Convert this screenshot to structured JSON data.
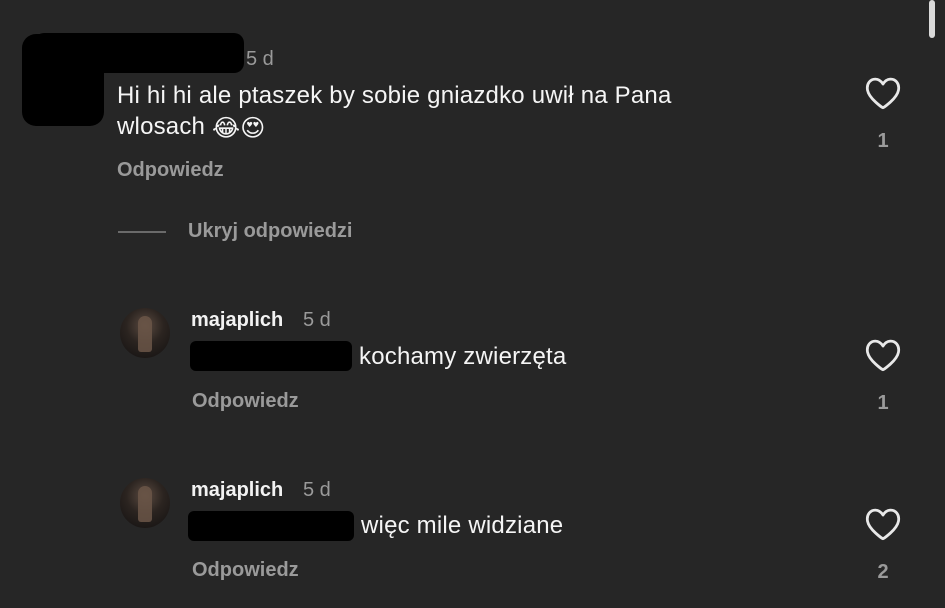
{
  "thread": {
    "hide_replies_label": "Ukryj odpowiedzi",
    "reply_label": "Odpowiedz"
  },
  "comment": {
    "time": "5 d",
    "text_line1": "Hi hi hi  ale ptaszek by sobie gniazdko uwił na Pana",
    "text_line2": "wlosach",
    "emoji1": "😂",
    "emoji2": "😍",
    "likes": "1"
  },
  "replies": [
    {
      "username": "majaplich",
      "time": "5 d",
      "text": "kochamy zwierzęta",
      "likes": "1"
    },
    {
      "username": "majaplich",
      "time": "5 d",
      "text": "więc mile widziane",
      "likes": "2"
    }
  ],
  "icons": {
    "like": "heart-outline-icon"
  },
  "colors": {
    "background": "#262626",
    "text": "#f5f5f5",
    "muted": "#9a9a9a",
    "redaction": "#000000"
  }
}
